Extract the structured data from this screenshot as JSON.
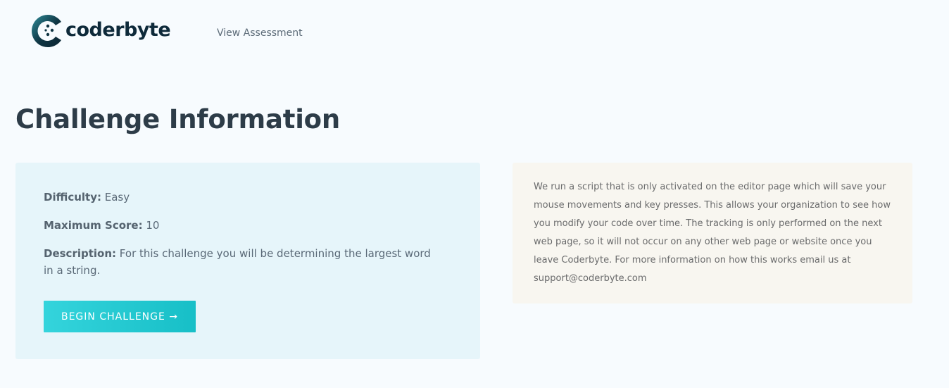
{
  "header": {
    "logo_text": "coderbyte",
    "nav_link": "View Assessment"
  },
  "page": {
    "title": "Challenge Information"
  },
  "challenge": {
    "difficulty_label": "Difficulty:",
    "difficulty_value": "Easy",
    "score_label": "Maximum Score:",
    "score_value": "10",
    "description_label": "Description:",
    "description_value": "For this challenge you will be determining the largest word in a string.",
    "begin_button": "BEGIN CHALLENGE →"
  },
  "notice": {
    "text": "We run a script that is only activated on the editor page which will save your mouse movements and key presses. This allows your organization to see how you modify your code over time. The tracking is only performed on the next web page, so it will not occur on any other web page or website once you leave Coderbyte. For more information on how this works email us at support@coderbyte.com"
  },
  "colors": {
    "background": "#f7fbfe",
    "info_card": "#e6f5fa",
    "notice_card": "#f8f6f0",
    "button_start": "#34d4dc",
    "button_end": "#17bfc7",
    "brand_dark": "#0e2a3a"
  }
}
